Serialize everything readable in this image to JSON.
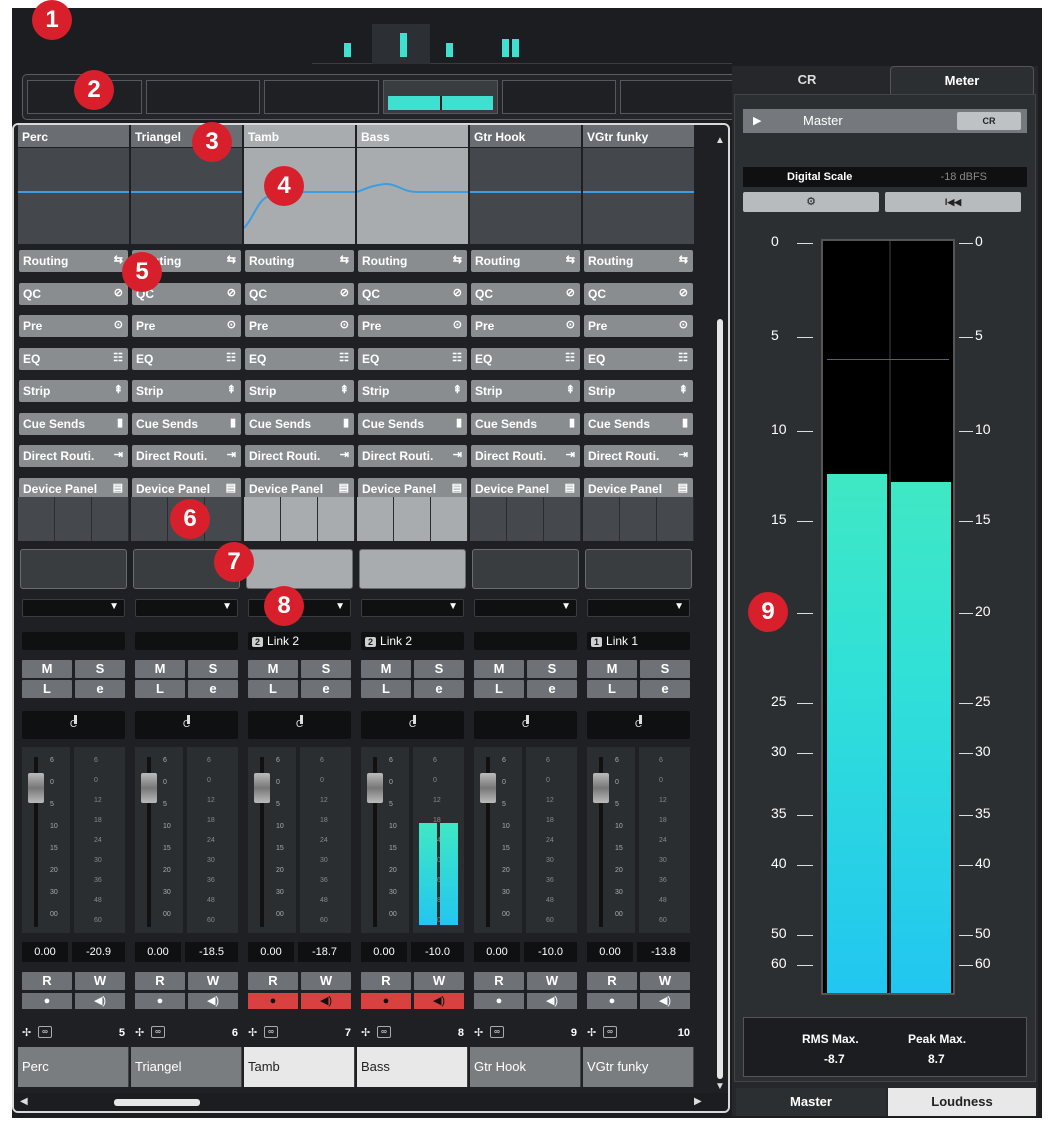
{
  "callouts": [
    "1",
    "2",
    "3",
    "4",
    "5",
    "6",
    "7",
    "8",
    "9"
  ],
  "strips": [
    {
      "name": "Perc",
      "link": "",
      "link_num": "",
      "num": "5",
      "vol": "0.00",
      "peak": "-20.9",
      "selected": false,
      "meter": 0
    },
    {
      "name": "Triangel",
      "link": "",
      "link_num": "",
      "num": "6",
      "vol": "0.00",
      "peak": "-18.5",
      "selected": false,
      "meter": 0
    },
    {
      "name": "Tamb",
      "link": "Link 2",
      "link_num": "2",
      "num": "7",
      "vol": "0.00",
      "peak": "-18.7",
      "selected": true,
      "meter": 0
    },
    {
      "name": "Bass",
      "link": "Link 2",
      "link_num": "2",
      "num": "8",
      "vol": "0.00",
      "peak": "-10.0",
      "selected": true,
      "meter": 0.6
    },
    {
      "name": "Gtr Hook",
      "link": "",
      "link_num": "",
      "num": "9",
      "vol": "0.00",
      "peak": "-10.0",
      "selected": false,
      "meter": 0
    },
    {
      "name": "VGtr funky",
      "link": "Link 1",
      "link_num": "1",
      "num": "10",
      "vol": "0.00",
      "peak": "-13.8",
      "selected": false,
      "meter": 0
    }
  ],
  "sections": [
    "Routing",
    "QC",
    "Pre",
    "EQ",
    "Strip",
    "Cue Sends",
    "Direct Routi.",
    "Device Panel"
  ],
  "buttons": {
    "mute": "M",
    "solo": "S",
    "listen": "L",
    "edit": "e",
    "read": "R",
    "write": "W"
  },
  "pan_label": "C",
  "fader_scale": [
    "6",
    "0",
    "5",
    "10",
    "15",
    "20",
    "30",
    "00"
  ],
  "meter_scale": [
    "6",
    "0",
    "12",
    "18",
    "24",
    "30",
    "36",
    "48",
    "60"
  ],
  "right_panel": {
    "tabs_top": [
      "CR",
      "Meter"
    ],
    "active_top": "Meter",
    "master_label": "Master",
    "cr_button": "CR",
    "scale_label": "Digital Scale",
    "scale_value": "-18 dBFS",
    "gear_icon": "⚙",
    "reset_icon": "I◀◀",
    "scale_left": [
      "0",
      "5",
      "10",
      "15",
      "20",
      "25",
      "30",
      "35",
      "40",
      "50",
      "60"
    ],
    "scale_right": [
      "0",
      "5",
      "10",
      "15",
      "20",
      "25",
      "30",
      "35",
      "40",
      "50",
      "60"
    ],
    "meter_left_level": 0.69,
    "meter_right_level": 0.68,
    "rms_label": "RMS Max.",
    "rms_value": "-8.7",
    "peak_label": "Peak Max.",
    "peak_value": "8.7",
    "tabs_bottom": [
      "Master",
      "Loudness"
    ],
    "active_bottom": "Master"
  }
}
